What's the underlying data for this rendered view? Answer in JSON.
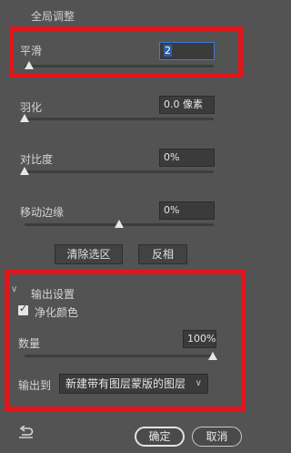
{
  "section_global": {
    "title": "全局调整"
  },
  "smooth": {
    "label": "平滑",
    "value": "2",
    "slider": 0.02
  },
  "feather": {
    "label": "羽化",
    "value": "0.0 像素",
    "slider": 0.0
  },
  "contrast": {
    "label": "对比度",
    "value": "0%",
    "slider": 0.0
  },
  "shift_edge": {
    "label": "移动边缘",
    "value": "0%",
    "slider": 0.5
  },
  "buttons": {
    "clear_selection": "清除选区",
    "invert": "反相"
  },
  "output": {
    "title": "输出设置",
    "decontaminate_label": "净化颜色",
    "decontaminate_checked": true,
    "amount_label": "数量",
    "amount_value": "100%",
    "amount_slider": 1.0,
    "output_to_label": "输出到",
    "output_to_value": "新建带有图层蒙版的图层"
  },
  "footer": {
    "ok": "确定",
    "cancel": "取消"
  },
  "colors": {
    "highlight": "#e3151b",
    "focus": "#3a7bd5"
  }
}
